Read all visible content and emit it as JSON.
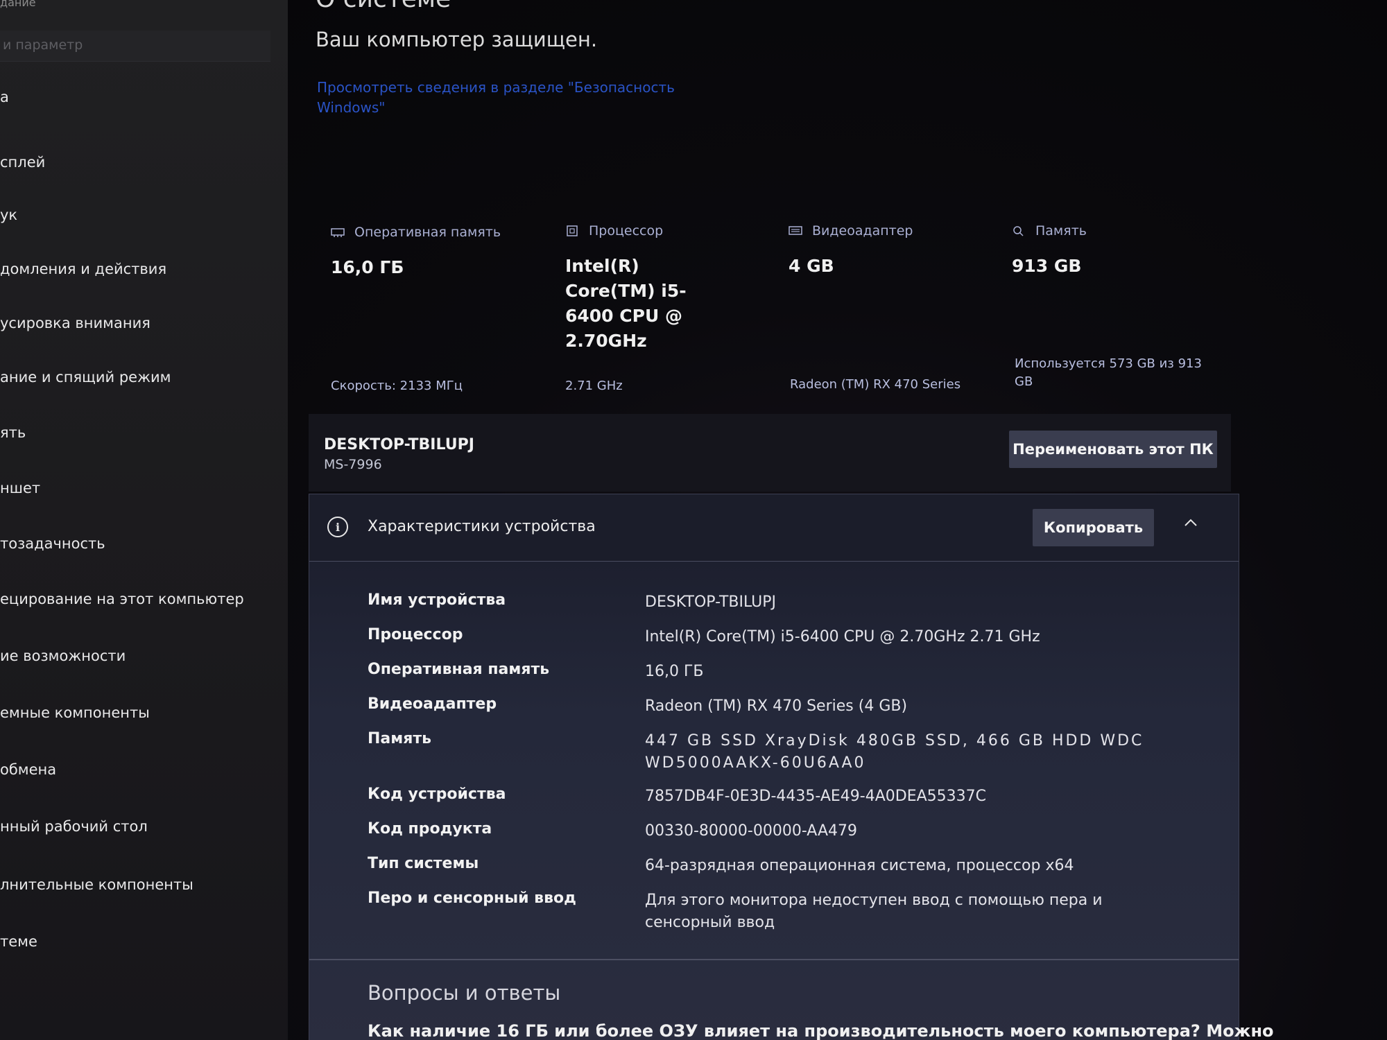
{
  "sidebar": {
    "top_caption": "дание",
    "search_placeholder": "и параметр",
    "items": [
      {
        "label": "а"
      },
      {
        "label": "сплей"
      },
      {
        "label": "ук"
      },
      {
        "label": "домления и действия"
      },
      {
        "label": "усировка внимания"
      },
      {
        "label": "ание и спящий режим"
      },
      {
        "label": "ять"
      },
      {
        "label": "ншет"
      },
      {
        "label": "тозадачность"
      },
      {
        "label": "ецирование на этот компьютер"
      },
      {
        "label": "ие возможности"
      },
      {
        "label": "емные компоненты"
      },
      {
        "label": "обмена"
      },
      {
        "label": "нный рабочий стол"
      },
      {
        "label": "лнительные компоненты"
      },
      {
        "label": "теме"
      }
    ]
  },
  "header": {
    "title": "О системе",
    "protected": "Ваш компьютер защищен.",
    "security_link": "Просмотреть сведения в разделе \"Безопасность Windows\""
  },
  "summary": {
    "ram": {
      "label": "Оперативная память",
      "value": "16,0 ГБ",
      "sub": "Скорость: 2133 МГц",
      "icon": "memory-icon"
    },
    "cpu": {
      "label": "Процессор",
      "value": "Intel(R) Core(TM) i5-6400 CPU @ 2.70GHz",
      "sub": "2.71 GHz",
      "icon": "processor-icon"
    },
    "gpu": {
      "label": "Видеоадаптер",
      "value": "4 GB",
      "sub": "Radeon (TM) RX 470 Series",
      "icon": "gpu-icon"
    },
    "storage": {
      "label": "Память",
      "value": "913 GB",
      "sub": "Используется 573 GB из 913 GB",
      "icon": "storage-icon"
    }
  },
  "pc": {
    "name": "DESKTOP-TBILUPJ",
    "model": "MS-7996",
    "rename_label": "Переименовать этот ПК"
  },
  "specs": {
    "title": "Характеристики устройства",
    "copy_label": "Копировать",
    "rows": [
      {
        "key": "Имя устройства",
        "value": "DESKTOP-TBILUPJ"
      },
      {
        "key": "Процессор",
        "value": "Intel(R) Core(TM) i5-6400 CPU @ 2.70GHz   2.71 GHz"
      },
      {
        "key": "Оперативная память",
        "value": "16,0 ГБ"
      },
      {
        "key": "Видеоадаптер",
        "value": "Radeon (TM) RX 470 Series (4 GB)"
      },
      {
        "key": "Память",
        "value": "447 GB SSD XrayDisk 480GB SSD, 466 GB HDD WDC WD5000AAKX-60U6AA0"
      },
      {
        "key": "Код устройства",
        "value": "7857DB4F-0E3D-4435-AE49-4A0DEA55337C"
      },
      {
        "key": "Код продукта",
        "value": "00330-80000-00000-AA479"
      },
      {
        "key": "Тип системы",
        "value": "64-разрядная операционная система, процессор x64"
      },
      {
        "key": "Перо и сенсорный ввод",
        "value": "Для этого монитора недоступен ввод с помощью пера и сенсорный ввод"
      }
    ]
  },
  "faq": {
    "title": "Вопросы и ответы",
    "question": "Как наличие 16 ГБ или более ОЗУ влияет на производительность моего компьютера? Можно"
  },
  "colors": {
    "link": "#2a53c6",
    "button": "#3a3d4f",
    "panel": "#24283a"
  }
}
